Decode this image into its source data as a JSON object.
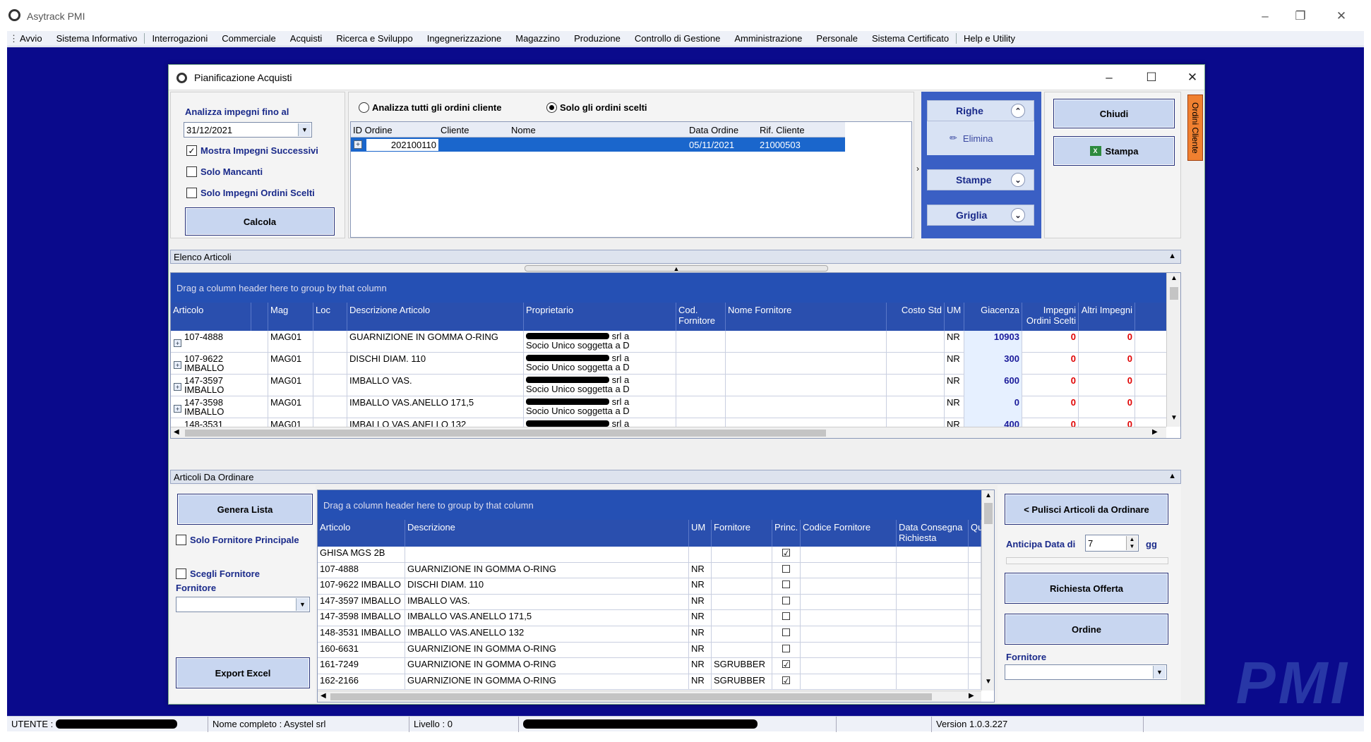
{
  "app": {
    "title": "Asytrack PMI",
    "logo_text": "PMI"
  },
  "menu": [
    "Avvio",
    "Sistema Informativo",
    "Interrogazioni",
    "Commerciale",
    "Acquisti",
    "Ricerca e Sviluppo",
    "Ingegnerizzazione",
    "Magazzino",
    "Produzione",
    "Controllo di Gestione",
    "Amministrazione",
    "Personale",
    "Sistema Certificato",
    "Help e Utility"
  ],
  "dialog": {
    "title": "Pianificazione Acquisti",
    "left": {
      "label": "Analizza impegni fino al",
      "date": "31/12/2021",
      "chk_successivi": "Mostra Impegni Successivi",
      "chk_mancanti": "Solo Mancanti",
      "chk_scelti": "Solo Impegni Ordini Scelti",
      "calcola": "Calcola"
    },
    "radio_all": "Analizza tutti gli ordini cliente",
    "radio_sel": "Solo gli ordini scelti",
    "orders": {
      "headers": [
        "ID Ordine",
        "Cliente",
        "Nome",
        "Data Ordine",
        "Rif. Cliente"
      ],
      "rows": [
        {
          "id": "202100110",
          "cliente": "",
          "nome": "",
          "data": "05/11/2021",
          "rif": "21000503"
        }
      ]
    },
    "panel": {
      "righe": "Righe",
      "elimina": "Elimina",
      "stampe": "Stampe",
      "griglia": "Griglia"
    },
    "btn_chiudi": "Chiudi",
    "btn_stampa": "Stampa",
    "side_tab": "Ordini Cliente",
    "elenco": {
      "title": "Elenco Articoli",
      "group_hint": "Drag a column header here to group by that column",
      "headers": [
        "Articolo",
        "Mag",
        "Loc",
        "Descrizione Articolo",
        "Proprietario",
        "Cod. Fornitore",
        "Nome Fornitore",
        "Costo Std",
        "UM",
        "Giacenza",
        "Impegni Ordini Scelti",
        "Altri Impegni"
      ],
      "owner_suffix": "srl a",
      "owner_line2": "Socio Unico soggetta a D",
      "rows": [
        {
          "art": "107-4888",
          "art2": "",
          "mag": "MAG01",
          "desc": "GUARNIZIONE IN GOMMA O-RING",
          "um": "NR",
          "giac": "10903",
          "imp": "0",
          "altri": "0"
        },
        {
          "art": "107-9622",
          "art2": "IMBALLO",
          "mag": "MAG01",
          "desc": "DISCHI DIAM. 110",
          "um": "NR",
          "giac": "300",
          "imp": "0",
          "altri": "0"
        },
        {
          "art": "147-3597",
          "art2": "IMBALLO",
          "mag": "MAG01",
          "desc": "IMBALLO VAS.",
          "um": "NR",
          "giac": "600",
          "imp": "0",
          "altri": "0"
        },
        {
          "art": "147-3598",
          "art2": "IMBALLO",
          "mag": "MAG01",
          "desc": "IMBALLO VAS.ANELLO 171,5",
          "um": "NR",
          "giac": "0",
          "imp": "0",
          "altri": "0"
        },
        {
          "art": "148-3531",
          "art2": "",
          "mag": "MAG01",
          "desc": "IMBALLO VAS.ANELLO 132",
          "um": "NR",
          "giac": "400",
          "imp": "0",
          "altri": "0"
        }
      ]
    },
    "ordinare": {
      "title": "Articoli Da Ordinare",
      "genera": "Genera Lista",
      "chk_principale": "Solo Fornitore Principale",
      "chk_scegli": "Scegli Fornitore",
      "fornitore_label": "Fornitore",
      "export": "Export Excel",
      "group_hint": "Drag a column header here to group by that column",
      "headers": [
        "Articolo",
        "Descrizione",
        "UM",
        "Fornitore",
        "Princ.",
        "Codice Fornitore",
        "Data Consegna Richiesta",
        "Qu"
      ],
      "rows": [
        {
          "art": "GHISA MGS 2B",
          "desc": "",
          "um": "",
          "forn": "",
          "princ": "☑"
        },
        {
          "art": "107-4888",
          "desc": "GUARNIZIONE IN GOMMA O-RING",
          "um": "NR",
          "forn": "",
          "princ": "☐"
        },
        {
          "art": "107-9622 IMBALLO",
          "desc": "DISCHI DIAM. 110",
          "um": "NR",
          "forn": "",
          "princ": "☐"
        },
        {
          "art": "147-3597 IMBALLO",
          "desc": "IMBALLO VAS.",
          "um": "NR",
          "forn": "",
          "princ": "☐"
        },
        {
          "art": "147-3598 IMBALLO",
          "desc": "IMBALLO VAS.ANELLO 171,5",
          "um": "NR",
          "forn": "",
          "princ": "☐"
        },
        {
          "art": "148-3531 IMBALLO",
          "desc": "IMBALLO VAS.ANELLO 132",
          "um": "NR",
          "forn": "",
          "princ": "☐"
        },
        {
          "art": "160-6631",
          "desc": "GUARNIZIONE IN GOMMA O-RING",
          "um": "NR",
          "forn": "",
          "princ": "☐"
        },
        {
          "art": "161-7249",
          "desc": "GUARNIZIONE IN GOMMA O-RING",
          "um": "NR",
          "forn": "SGRUBBER",
          "princ": "☑"
        },
        {
          "art": "162-2166",
          "desc": "GUARNIZIONE IN GOMMA O-RING",
          "um": "NR",
          "forn": "SGRUBBER",
          "princ": "☑"
        }
      ],
      "pulisci": "< Pulisci Articoli da Ordinare",
      "anticipa_label": "Anticipa Data di",
      "anticipa_value": "7",
      "anticipa_unit": "gg",
      "richiesta": "Richiesta Offerta",
      "ordine": "Ordine",
      "fornitore_right": "Fornitore"
    }
  },
  "status": {
    "utente": "UTENTE :",
    "nome": "Nome completo : Asystel srl",
    "livello": "Livello : 0",
    "version": "Version 1.0.3.227"
  }
}
